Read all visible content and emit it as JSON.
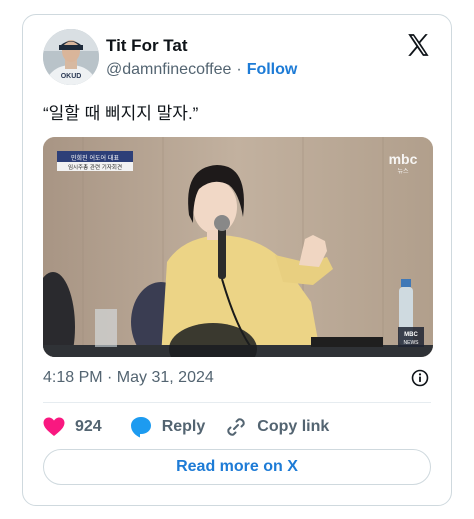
{
  "author": {
    "display_name": "Tit For Tat",
    "handle": "@damnfinecoffee",
    "separator": "·",
    "follow_label": "Follow",
    "avatar_jersey_text": "OKUD"
  },
  "tweet": {
    "text": "“일할 때 삐지지 말자.”",
    "timestamp": "4:18 PM · May 31, 2024"
  },
  "media": {
    "caption_line1": "민희진 어도어 대표",
    "caption_line2": "임시주총 관련 기자회견",
    "broadcaster_logo": "mbc",
    "broadcaster_sub": "뉴스",
    "corner_badge_line1": "MBC",
    "corner_badge_line2": "NEWS"
  },
  "actions": {
    "like_count": "924",
    "reply_label": "Reply",
    "copy_link_label": "Copy link"
  },
  "footer": {
    "read_more_label": "Read more on X"
  },
  "colors": {
    "accent_blue": "#1d7bd6",
    "like_pink": "#f91880",
    "muted": "#536471",
    "text": "#0f1419",
    "border": "#cfd9de"
  },
  "icons": [
    "x-logo-icon",
    "info-icon",
    "heart-icon",
    "reply-bubble-icon",
    "link-icon"
  ]
}
